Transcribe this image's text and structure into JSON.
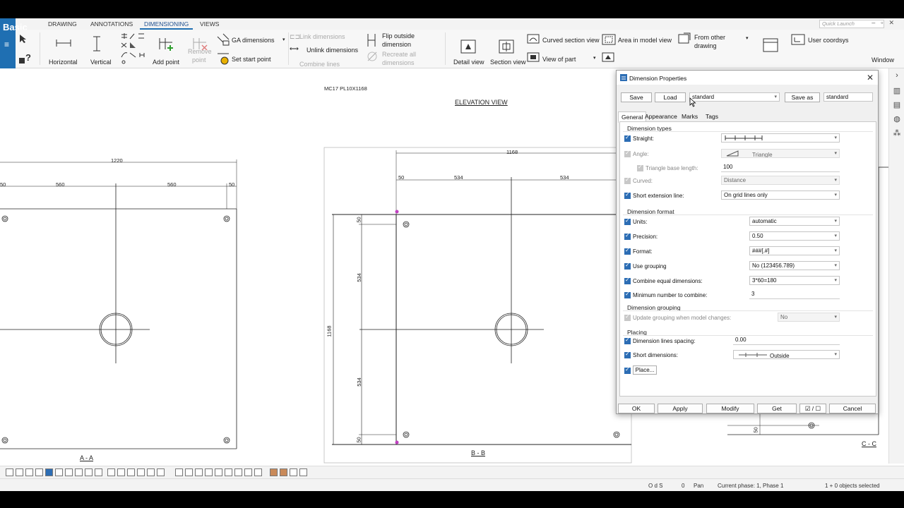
{
  "app": {
    "brand": "Basic",
    "quick_launch_placeholder": "Quick Launch"
  },
  "menu_tabs": [
    "DRAWING",
    "ANNOTATIONS",
    "DIMENSIONING",
    "VIEWS"
  ],
  "ribbon": {
    "horizontal": "Horizontal",
    "vertical": "Vertical",
    "add_point": "Add point",
    "remove_point_1": "Remove",
    "remove_point_2": "point",
    "ga_dimensions": "GA dimensions",
    "set_start_point": "Set start point",
    "link_dimensions": "Link dimensions",
    "unlink_dimensions": "Unlink dimensions",
    "combine_lines": "Combine lines",
    "flip_outside_1": "Flip outside",
    "flip_outside_2": "dimension",
    "recreate_all_1": "Recreate all",
    "recreate_all_2": "dimensions",
    "detail_view": "Detail view",
    "section_view": "Section view",
    "curved_section_view": "Curved section view",
    "view_of_part": "View of part",
    "area_in_model_view": "Area in model view",
    "from_other_drawing_1": "From other",
    "from_other_drawing_2": "drawing",
    "user_coordsys": "User coordsys",
    "window": "Window"
  },
  "drawing": {
    "part_mark": "MC17 PL10X1168",
    "elevation_title": "ELEVATION VIEW",
    "view_aa": {
      "label": "A - A",
      "overall": "1220",
      "dim_left": "50",
      "dim_a": "560",
      "dim_b": "560",
      "dim_c": "50"
    },
    "view_bb": {
      "label": "B - B",
      "overall": "1168",
      "dim_left": "50",
      "dim_a": "534",
      "dim_b": "534",
      "vert_total": "1168",
      "vert_top": "50",
      "vert_a": "534",
      "vert_b": "534",
      "vert_bottom": "50"
    },
    "view_cc": {
      "label": "C - C",
      "dim": "50"
    }
  },
  "dialog": {
    "title": "Dimension Properties",
    "save": "Save",
    "load": "Load",
    "preset": "standard",
    "save_as": "Save as",
    "save_as_name": "standard",
    "tabs": [
      "General",
      "Appearance",
      "Marks",
      "Tags"
    ],
    "groups": {
      "types": "Dimension types",
      "format": "Dimension format",
      "grouping": "Dimension grouping",
      "placing": "Placing"
    },
    "rows": {
      "straight": {
        "label": "Straight:"
      },
      "angle": {
        "label": "Angle:",
        "value": "Triangle"
      },
      "triangle_base": {
        "label": "Triangle base length:",
        "value": "100"
      },
      "curved": {
        "label": "Curved:",
        "value": "Distance"
      },
      "short_ext": {
        "label": "Short extension line:",
        "value": "On grid lines only"
      },
      "units": {
        "label": "Units:",
        "value": "automatic"
      },
      "precision": {
        "label": "Precision:",
        "value": "0.50"
      },
      "format": {
        "label": "Format:",
        "value": "###[.#]"
      },
      "use_grouping": {
        "label": "Use grouping",
        "value": "No (123456.789)"
      },
      "combine_equal": {
        "label": "Combine equal dimensions:",
        "value": "3*60=180"
      },
      "min_combine": {
        "label": "Minimum number to combine:",
        "value": "3"
      },
      "update_grouping": {
        "label": "Update grouping when model changes:",
        "value": "No"
      },
      "lines_spacing": {
        "label": "Dimension lines spacing:",
        "value": "0.00"
      },
      "short_dims": {
        "label": "Short dimensions:",
        "value": "Outside"
      },
      "place": {
        "label": "Place..."
      }
    },
    "footer": {
      "ok": "OK",
      "apply": "Apply",
      "modify": "Modify",
      "get": "Get",
      "toggle": "☑ / ☐",
      "cancel": "Cancel"
    }
  },
  "status": {
    "snap": "O d S",
    "zero": "0",
    "pan": "Pan",
    "phase": "Current phase: 1, Phase 1",
    "selection": "1 + 0 objects selected"
  },
  "colors": {
    "brand": "#1f6fb2",
    "checkbox": "#2c6db4",
    "handle": "#c040c0"
  }
}
